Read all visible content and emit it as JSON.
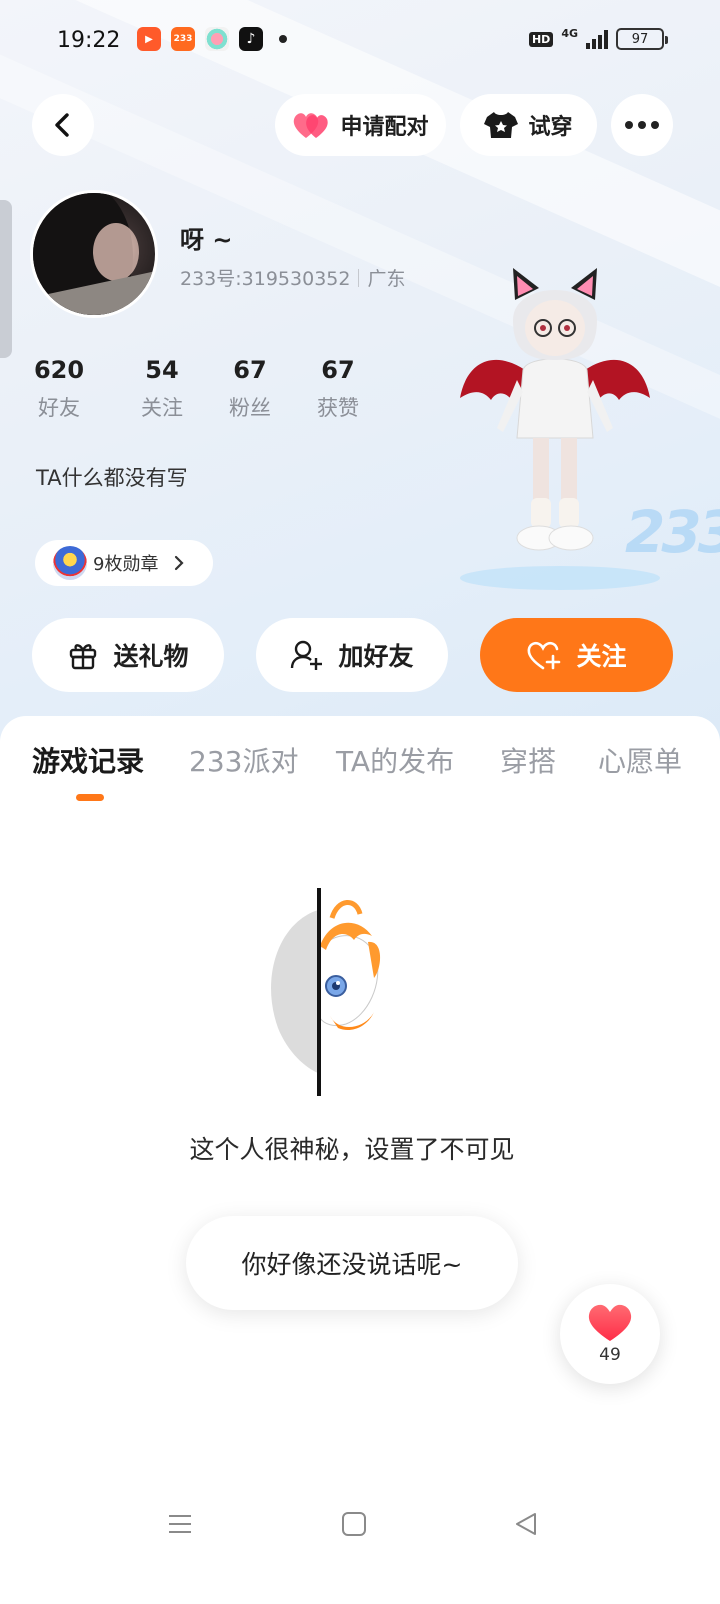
{
  "status_bar": {
    "time": "19:22",
    "app_icons": [
      {
        "name": "video-app-icon",
        "color": "#ff5a2a",
        "label": "▶"
      },
      {
        "name": "233-app-icon",
        "color": "#ff6a1f",
        "label": "233"
      },
      {
        "name": "circle-app-icon",
        "color": "#f2f2f2",
        "label": ""
      },
      {
        "name": "tiktok-app-icon",
        "color": "#111111",
        "label": "♪"
      }
    ],
    "hd_label": "HD",
    "network": "4G",
    "battery": "97"
  },
  "top_nav": {
    "pair_label": "申请配对",
    "try_on_label": "试穿"
  },
  "profile": {
    "name": "呀 ~",
    "id_text": "233号:319530352",
    "region": "广东",
    "bio": "TA什么都没有写",
    "medals_label": "9枚勋章",
    "stats": [
      {
        "value": "620",
        "label": "好友"
      },
      {
        "value": "54",
        "label": "关注"
      },
      {
        "value": "67",
        "label": "粉丝"
      },
      {
        "value": "67",
        "label": "获赞"
      }
    ]
  },
  "actions": {
    "gift_label": "送礼物",
    "add_friend_label": "加好友",
    "follow_label": "关注"
  },
  "tabs": [
    {
      "label": "游戏记录",
      "active": true
    },
    {
      "label": "233派对",
      "active": false
    },
    {
      "label": "TA的发布",
      "active": false
    },
    {
      "label": "穿搭",
      "active": false
    },
    {
      "label": "心愿单",
      "active": false
    }
  ],
  "empty_state": {
    "message": "这个人很神秘，设置了不可见"
  },
  "hint_bubble": "你好像还没说话呢~",
  "like": {
    "count": "49"
  },
  "colors": {
    "accent": "#ff7718",
    "heart": "#ff4b55"
  }
}
